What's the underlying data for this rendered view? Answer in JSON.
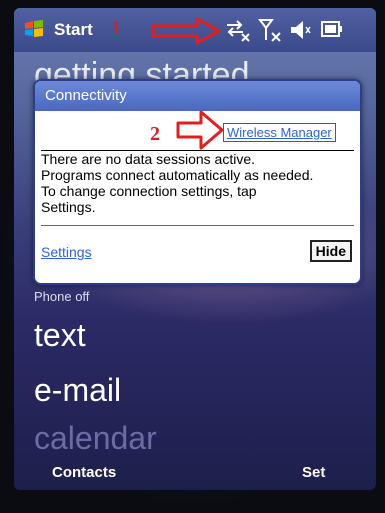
{
  "titlebar": {
    "start_label": "Start",
    "annotation_1": "1",
    "icons": [
      "windows-flag-icon",
      "data-connection-icon",
      "no-signal-icon",
      "speaker-muted-icon",
      "battery-icon"
    ]
  },
  "home": {
    "getting_started": "getting started",
    "phone_off": "Phone off",
    "text": "text",
    "email": "e-mail",
    "calendar": "calendar"
  },
  "softkeys": {
    "left": "Contacts",
    "right": "Set"
  },
  "popup": {
    "title": "Connectivity",
    "annotation_2": "2",
    "wireless_manager": "Wireless Manager",
    "message_lines": [
      "There are no data sessions active.",
      "Programs connect automatically as needed.",
      "To change connection settings, tap",
      "Settings."
    ],
    "settings_link": "Settings",
    "hide_button": "Hide"
  },
  "colors": {
    "annotation": "#d72020",
    "link": "#2f63d8",
    "title_bar": "#4a68c0"
  }
}
